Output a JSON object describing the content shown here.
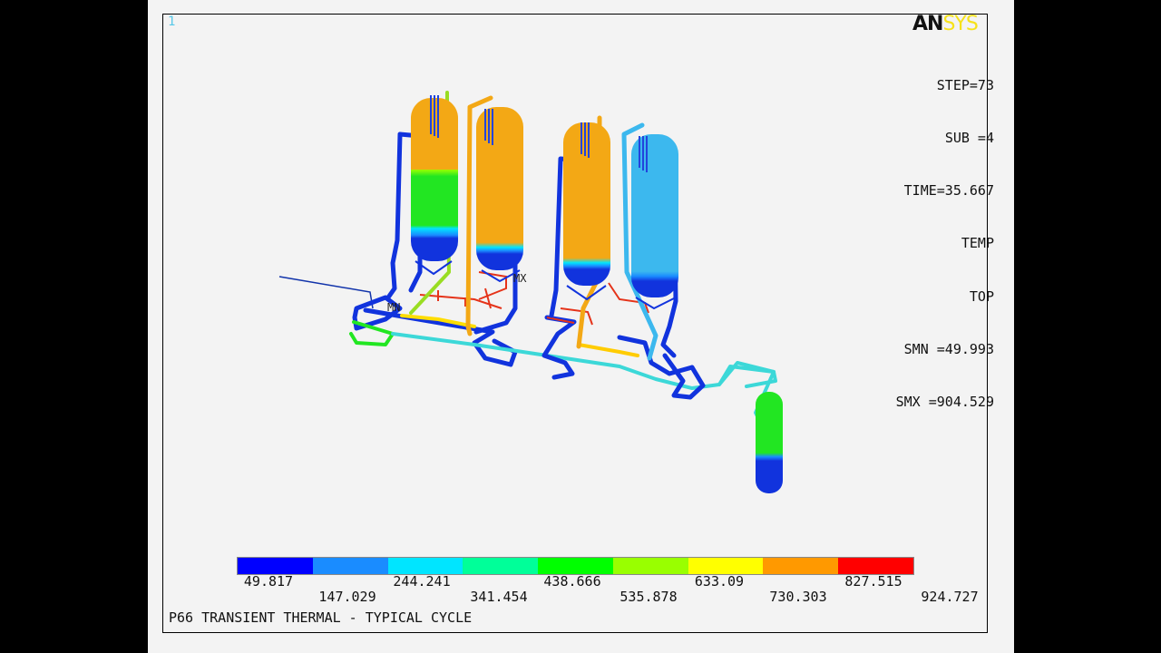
{
  "window_number": "1",
  "logo": {
    "part1": "AN",
    "part2": "SYS"
  },
  "info": {
    "lines": [
      "STEP=73",
      "SUB =4",
      "TIME=35.667",
      "TEMP",
      "TOP",
      "SMN =49.993",
      "SMX =904.529"
    ]
  },
  "markers": {
    "min": "MN",
    "max": "MX"
  },
  "legend": {
    "colors": [
      "#0000ff",
      "#1a8cff",
      "#00e5ff",
      "#00ff99",
      "#00ff00",
      "#99ff00",
      "#ffff00",
      "#ff9900",
      "#ff0000"
    ],
    "upper": [
      "49.817",
      "244.241",
      "438.666",
      "633.09",
      "827.515"
    ],
    "lower": [
      "147.029",
      "341.454",
      "535.878",
      "730.303",
      "924.727"
    ]
  },
  "title": "P66 TRANSIENT THERMAL - TYPICAL CYCLE"
}
